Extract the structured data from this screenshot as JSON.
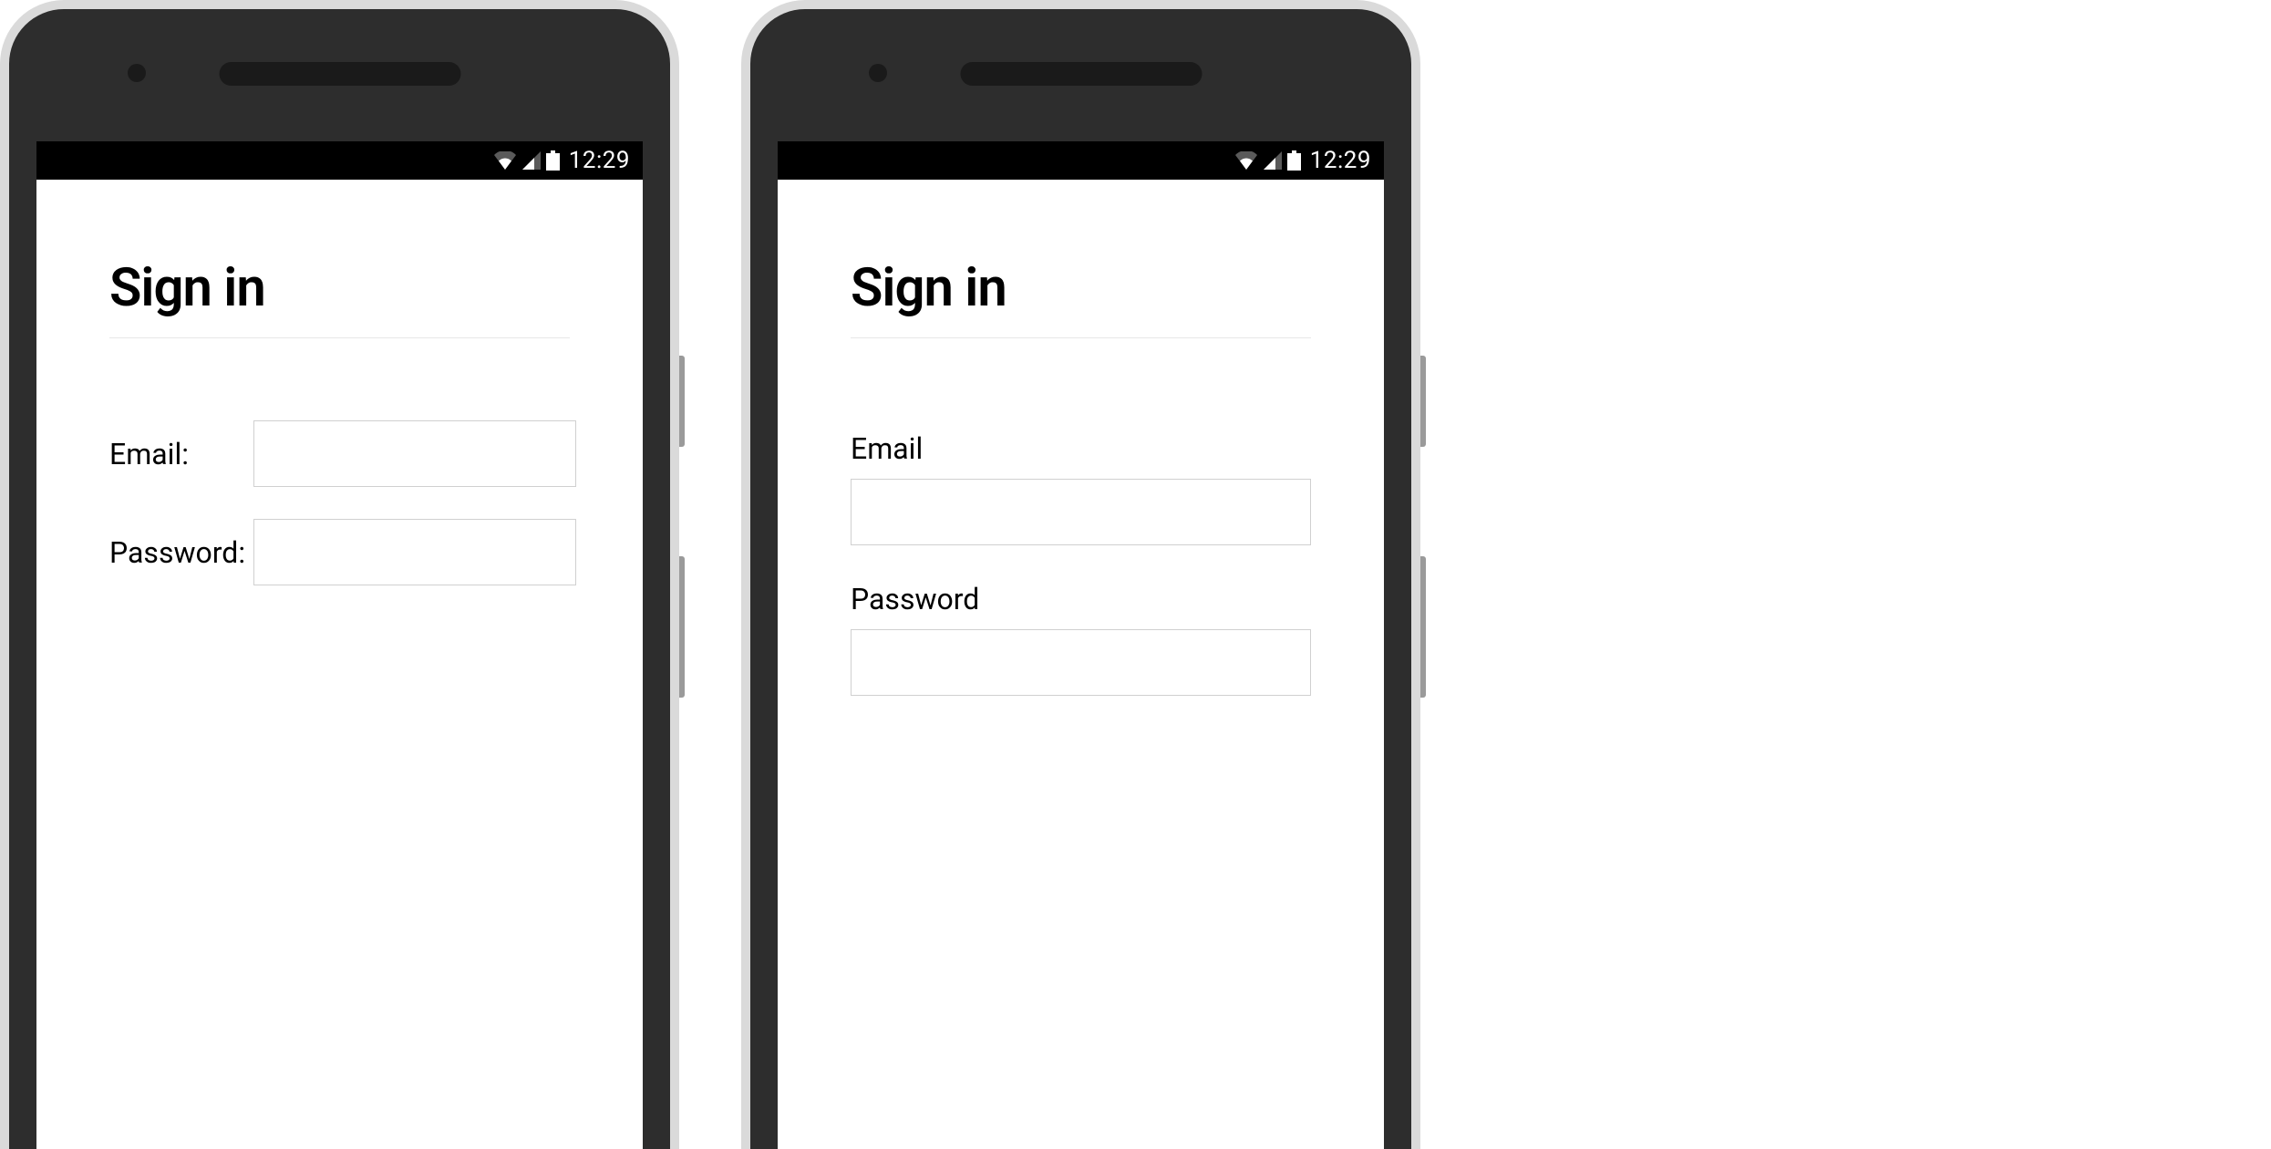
{
  "status": {
    "time": "12:29"
  },
  "left": {
    "title": "Sign in",
    "email_label": "Email:",
    "email_value": "",
    "password_label": "Password:",
    "password_value": ""
  },
  "right": {
    "title": "Sign in",
    "email_label": "Email",
    "email_value": "",
    "password_label": "Password",
    "password_value": ""
  }
}
